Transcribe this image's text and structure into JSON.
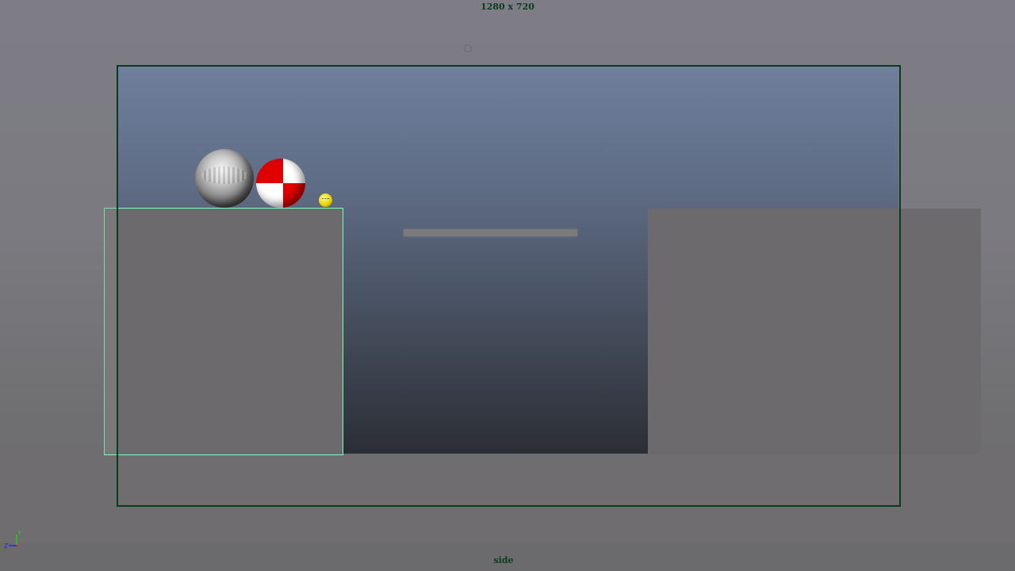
{
  "viewport": {
    "resolution_label": "1280 x 720",
    "camera_name": "side"
  },
  "axis_gizmo": {
    "labels": {
      "y": "Y",
      "z": "Z"
    },
    "colors": {
      "y": "#22cc22",
      "z": "#2222ff",
      "x": "#ff2222"
    }
  },
  "scene": {
    "objects": [
      {
        "name": "metal-sphere"
      },
      {
        "name": "checker-sphere",
        "colors": [
          "#ffffff",
          "#e00000"
        ]
      },
      {
        "name": "small-yellow-ball",
        "color": "#e8d400"
      },
      {
        "name": "left-block",
        "selected": true,
        "highlight_color": "#7affc0"
      },
      {
        "name": "right-block"
      },
      {
        "name": "floating-platform"
      }
    ]
  },
  "colors": {
    "gate_border": "#0c3a1e",
    "label_text": "#0b3a1c"
  }
}
